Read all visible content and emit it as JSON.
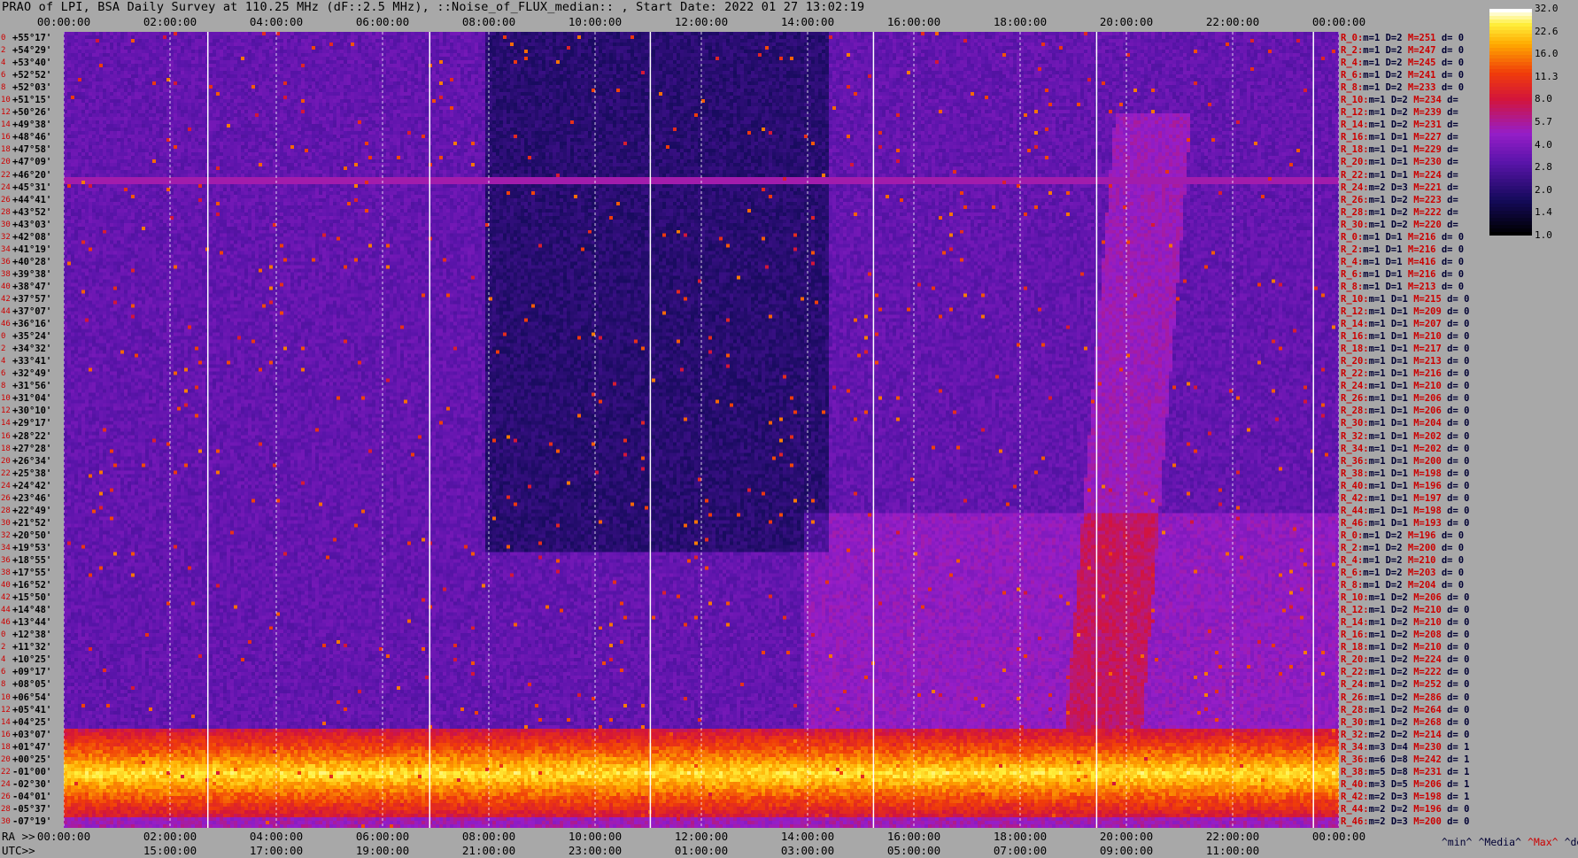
{
  "title": "PRAO of LPI, BSA Daily Survey at 110.25 MHz (dF::2.5 MHz), ::Noise_of_FLUX_median:: , Start Date: 2022 01 27 13:02:19",
  "axis_labels": {
    "ra": "RA >>",
    "utc": "UTC>>"
  },
  "legend": {
    "min": "^min^",
    "median": "^Media^",
    "max": "^Max^",
    "devia": "^devia^"
  },
  "colors": {
    "background": "#a8a8a8",
    "max_label": "#cc0000",
    "row_label": "#cc0000"
  },
  "chart_data": {
    "type": "heatmap",
    "x_top_ticks": [
      "00:00:00",
      "02:00:00",
      "04:00:00",
      "06:00:00",
      "08:00:00",
      "10:00:00",
      "12:00:00",
      "14:00:00",
      "16:00:00",
      "18:00:00",
      "20:00:00",
      "22:00:00",
      "00:00:00"
    ],
    "x_ra_ticks": [
      "00:00:00",
      "02:00:00",
      "04:00:00",
      "06:00:00",
      "08:00:00",
      "10:00:00",
      "12:00:00",
      "14:00:00",
      "16:00:00",
      "18:00:00",
      "20:00:00",
      "22:00:00",
      "00:00:00"
    ],
    "x_utc_ticks": [
      "15:00:00",
      "17:00:00",
      "19:00:00",
      "21:00:00",
      "23:00:00",
      "01:00:00",
      "03:00:00",
      "05:00:00",
      "07:00:00",
      "09:00:00",
      "11:00:00"
    ],
    "dec_labels": [
      "+55°17'",
      "+54°29'",
      "+53°40'",
      "+52°52'",
      "+52°03'",
      "+51°15'",
      "+50°26'",
      "+49°38'",
      "+48°46'",
      "+47°58'",
      "+47°09'",
      "+46°20'",
      "+45°31'",
      "+44°41'",
      "+43°52'",
      "+43°03'",
      "+42°08'",
      "+41°19'",
      "+40°28'",
      "+39°38'",
      "+38°47'",
      "+37°57'",
      "+37°07'",
      "+36°16'",
      "+35°24'",
      "+34°32'",
      "+33°41'",
      "+32°49'",
      "+31°56'",
      "+31°04'",
      "+30°10'",
      "+29°17'",
      "+28°22'",
      "+27°28'",
      "+26°34'",
      "+25°38'",
      "+24°42'",
      "+23°46'",
      "+22°49'",
      "+21°52'",
      "+20°50'",
      "+19°53'",
      "+18°55'",
      "+17°55'",
      "+16°52'",
      "+15°50'",
      "+14°48'",
      "+13°44'",
      "+12°38'",
      "+11°32'",
      "+10°25'",
      "+09°17'",
      "+08°05'",
      "+06°54'",
      "+05°41'",
      "+04°25'",
      "+03°07'",
      "+01°47'",
      "+00°25'",
      "-01°00'",
      "-02°30'",
      "-04°01'",
      "-05°37'",
      "-07°19'"
    ],
    "colorbar": {
      "scale": "log",
      "range": [
        1.0,
        32.0
      ],
      "ticks": [
        "32.0",
        "22.6",
        "16.0",
        "11.3",
        "8.0",
        "5.7",
        "4.0",
        "2.8",
        "2.0",
        "1.4",
        "1.0"
      ]
    },
    "stats": [
      {
        "r": "R_0:",
        "m": "m=1",
        "d": "D=2",
        "M": "M=251",
        "dv": "d= 0"
      },
      {
        "r": "R_2:",
        "m": "m=1",
        "d": "D=2",
        "M": "M=247",
        "dv": "d= 0"
      },
      {
        "r": "R_4:",
        "m": "m=1",
        "d": "D=2",
        "M": "M=245",
        "dv": "d= 0"
      },
      {
        "r": "R_6:",
        "m": "m=1",
        "d": "D=2",
        "M": "M=241",
        "dv": "d= 0"
      },
      {
        "r": "R_8:",
        "m": "m=1",
        "d": "D=2",
        "M": "M=233",
        "dv": "d= 0"
      },
      {
        "r": "R_10:",
        "m": "m=1",
        "d": "D=2",
        "M": "M=234",
        "dv": "d="
      },
      {
        "r": "R_12:",
        "m": "m=1",
        "d": "D=2",
        "M": "M=239",
        "dv": "d="
      },
      {
        "r": "R_14:",
        "m": "m=1",
        "d": "D=2",
        "M": "M=231",
        "dv": "d="
      },
      {
        "r": "R_16:",
        "m": "m=1",
        "d": "D=1",
        "M": "M=227",
        "dv": "d="
      },
      {
        "r": "R_18:",
        "m": "m=1",
        "d": "D=1",
        "M": "M=229",
        "dv": "d="
      },
      {
        "r": "R_20:",
        "m": "m=1",
        "d": "D=1",
        "M": "M=230",
        "dv": "d="
      },
      {
        "r": "R_22:",
        "m": "m=1",
        "d": "D=1",
        "M": "M=224",
        "dv": "d="
      },
      {
        "r": "R_24:",
        "m": "m=2",
        "d": "D=3",
        "M": "M=221",
        "dv": "d="
      },
      {
        "r": "R_26:",
        "m": "m=1",
        "d": "D=2",
        "M": "M=223",
        "dv": "d="
      },
      {
        "r": "R_28:",
        "m": "m=1",
        "d": "D=2",
        "M": "M=222",
        "dv": "d="
      },
      {
        "r": "R_30:",
        "m": "m=1",
        "d": "D=2",
        "M": "M=220",
        "dv": "d="
      },
      {
        "r": "R_0:",
        "m": "m=1",
        "d": "D=1",
        "M": "M=216",
        "dv": "d= 0"
      },
      {
        "r": "R_2:",
        "m": "m=1",
        "d": "D=1",
        "M": "M=216",
        "dv": "d= 0"
      },
      {
        "r": "R_4:",
        "m": "m=1",
        "d": "D=1",
        "M": "M=416",
        "dv": "d= 0"
      },
      {
        "r": "R_6:",
        "m": "m=1",
        "d": "D=1",
        "M": "M=216",
        "dv": "d= 0"
      },
      {
        "r": "R_8:",
        "m": "m=1",
        "d": "D=1",
        "M": "M=213",
        "dv": "d= 0"
      },
      {
        "r": "R_10:",
        "m": "m=1",
        "d": "D=1",
        "M": "M=215",
        "dv": "d= 0"
      },
      {
        "r": "R_12:",
        "m": "m=1",
        "d": "D=1",
        "M": "M=209",
        "dv": "d= 0"
      },
      {
        "r": "R_14:",
        "m": "m=1",
        "d": "D=1",
        "M": "M=207",
        "dv": "d= 0"
      },
      {
        "r": "R_16:",
        "m": "m=1",
        "d": "D=1",
        "M": "M=210",
        "dv": "d= 0"
      },
      {
        "r": "R_18:",
        "m": "m=1",
        "d": "D=1",
        "M": "M=217",
        "dv": "d= 0"
      },
      {
        "r": "R_20:",
        "m": "m=1",
        "d": "D=1",
        "M": "M=213",
        "dv": "d= 0"
      },
      {
        "r": "R_22:",
        "m": "m=1",
        "d": "D=1",
        "M": "M=216",
        "dv": "d= 0"
      },
      {
        "r": "R_24:",
        "m": "m=1",
        "d": "D=1",
        "M": "M=210",
        "dv": "d= 0"
      },
      {
        "r": "R_26:",
        "m": "m=1",
        "d": "D=1",
        "M": "M=206",
        "dv": "d= 0"
      },
      {
        "r": "R_28:",
        "m": "m=1",
        "d": "D=1",
        "M": "M=206",
        "dv": "d= 0"
      },
      {
        "r": "R_30:",
        "m": "m=1",
        "d": "D=1",
        "M": "M=204",
        "dv": "d= 0"
      },
      {
        "r": "R_32:",
        "m": "m=1",
        "d": "D=1",
        "M": "M=202",
        "dv": "d= 0"
      },
      {
        "r": "R_34:",
        "m": "m=1",
        "d": "D=1",
        "M": "M=202",
        "dv": "d= 0"
      },
      {
        "r": "R_36:",
        "m": "m=1",
        "d": "D=1",
        "M": "M=200",
        "dv": "d= 0"
      },
      {
        "r": "R_38:",
        "m": "m=1",
        "d": "D=1",
        "M": "M=198",
        "dv": "d= 0"
      },
      {
        "r": "R_40:",
        "m": "m=1",
        "d": "D=1",
        "M": "M=196",
        "dv": "d= 0"
      },
      {
        "r": "R_42:",
        "m": "m=1",
        "d": "D=1",
        "M": "M=197",
        "dv": "d= 0"
      },
      {
        "r": "R_44:",
        "m": "m=1",
        "d": "D=1",
        "M": "M=198",
        "dv": "d= 0"
      },
      {
        "r": "R_46:",
        "m": "m=1",
        "d": "D=1",
        "M": "M=193",
        "dv": "d= 0"
      },
      {
        "r": "R_0:",
        "m": "m=1",
        "d": "D=2",
        "M": "M=196",
        "dv": "d= 0"
      },
      {
        "r": "R_2:",
        "m": "m=1",
        "d": "D=2",
        "M": "M=200",
        "dv": "d= 0"
      },
      {
        "r": "R_4:",
        "m": "m=1",
        "d": "D=2",
        "M": "M=210",
        "dv": "d= 0"
      },
      {
        "r": "R_6:",
        "m": "m=1",
        "d": "D=2",
        "M": "M=203",
        "dv": "d= 0"
      },
      {
        "r": "R_8:",
        "m": "m=1",
        "d": "D=2",
        "M": "M=204",
        "dv": "d= 0"
      },
      {
        "r": "R_10:",
        "m": "m=1",
        "d": "D=2",
        "M": "M=206",
        "dv": "d= 0"
      },
      {
        "r": "R_12:",
        "m": "m=1",
        "d": "D=2",
        "M": "M=210",
        "dv": "d= 0"
      },
      {
        "r": "R_14:",
        "m": "m=1",
        "d": "D=2",
        "M": "M=210",
        "dv": "d= 0"
      },
      {
        "r": "R_16:",
        "m": "m=1",
        "d": "D=2",
        "M": "M=208",
        "dv": "d= 0"
      },
      {
        "r": "R_18:",
        "m": "m=1",
        "d": "D=2",
        "M": "M=210",
        "dv": "d= 0"
      },
      {
        "r": "R_20:",
        "m": "m=1",
        "d": "D=2",
        "M": "M=224",
        "dv": "d= 0"
      },
      {
        "r": "R_22:",
        "m": "m=1",
        "d": "D=2",
        "M": "M=222",
        "dv": "d= 0"
      },
      {
        "r": "R_24:",
        "m": "m=1",
        "d": "D=2",
        "M": "M=252",
        "dv": "d= 0"
      },
      {
        "r": "R_26:",
        "m": "m=1",
        "d": "D=2",
        "M": "M=286",
        "dv": "d= 0"
      },
      {
        "r": "R_28:",
        "m": "m=1",
        "d": "D=2",
        "M": "M=264",
        "dv": "d= 0"
      },
      {
        "r": "R_30:",
        "m": "m=1",
        "d": "D=2",
        "M": "M=268",
        "dv": "d= 0"
      },
      {
        "r": "R_32:",
        "m": "m=2",
        "d": "D=2",
        "M": "M=214",
        "dv": "d= 0"
      },
      {
        "r": "R_34:",
        "m": "m=3",
        "d": "D=4",
        "M": "M=230",
        "dv": "d= 1"
      },
      {
        "r": "R_36:",
        "m": "m=6",
        "d": "D=8",
        "M": "M=242",
        "dv": "d= 1"
      },
      {
        "r": "R_38:",
        "m": "m=5",
        "d": "D=8",
        "M": "M=231",
        "dv": "d= 1"
      },
      {
        "r": "R_40:",
        "m": "m=3",
        "d": "D=5",
        "M": "M=206",
        "dv": "d= 1"
      },
      {
        "r": "R_42:",
        "m": "m=2",
        "d": "D=3",
        "M": "M=198",
        "dv": "d= 1"
      },
      {
        "r": "R_44:",
        "m": "m=2",
        "d": "D=2",
        "M": "M=196",
        "dv": "d= 0"
      },
      {
        "r": "R_46:",
        "m": "m=2",
        "d": "D=3",
        "M": "M=200",
        "dv": "d= 0"
      }
    ]
  }
}
